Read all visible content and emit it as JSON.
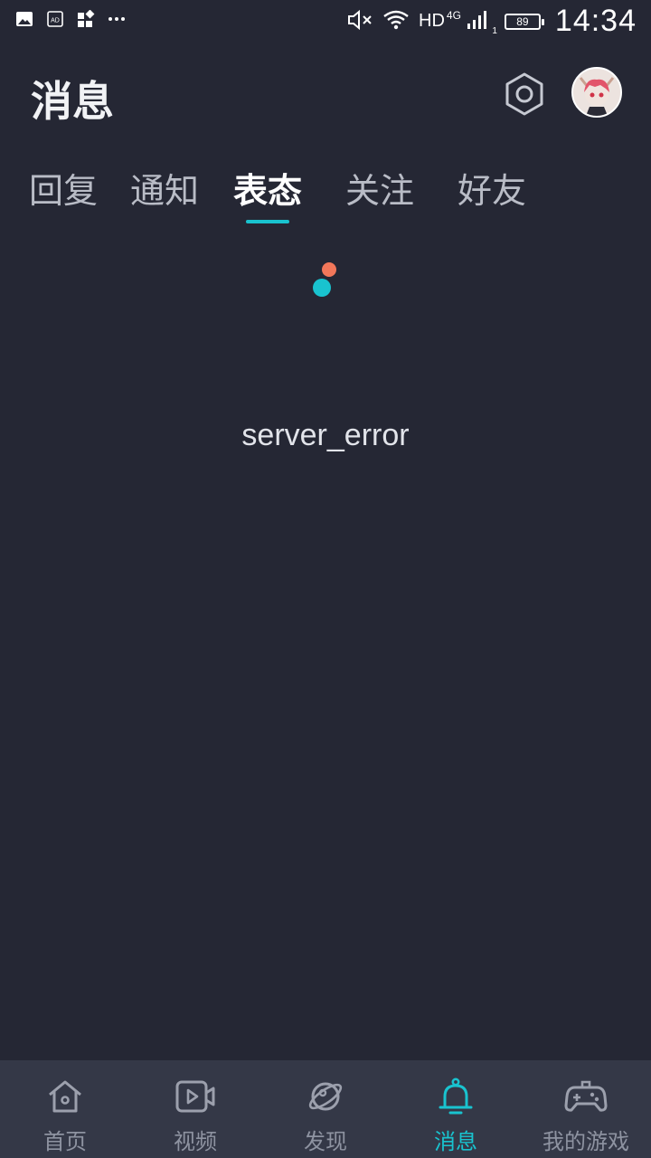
{
  "status_bar": {
    "left_icons": [
      "image-icon",
      "ad-icon",
      "widgets-icon",
      "more-dots-icon"
    ],
    "network_label": "HD",
    "network_type": "4G",
    "signal_sub": "1",
    "battery_level": "89",
    "time": "14:34"
  },
  "header": {
    "title": "消息",
    "settings_icon": "hexagon-settings-icon",
    "avatar": "user-avatar"
  },
  "tabs": {
    "items": [
      {
        "label": "回复"
      },
      {
        "label": "通知"
      },
      {
        "label": "表态"
      },
      {
        "label": "关注"
      },
      {
        "label": "好友"
      }
    ],
    "active_index": 2
  },
  "content": {
    "error_message": "server_error"
  },
  "bottom_nav": {
    "items": [
      {
        "label": "首页",
        "icon": "home-icon"
      },
      {
        "label": "视频",
        "icon": "video-icon"
      },
      {
        "label": "发现",
        "icon": "planet-icon"
      },
      {
        "label": "消息",
        "icon": "bell-icon"
      },
      {
        "label": "我的游戏",
        "icon": "gamepad-icon"
      }
    ],
    "active_index": 3
  },
  "colors": {
    "background": "#252734",
    "nav_background": "#343847",
    "accent": "#19c3cf",
    "loader_orange": "#f2775a",
    "inactive_text": "#8e93a1"
  }
}
